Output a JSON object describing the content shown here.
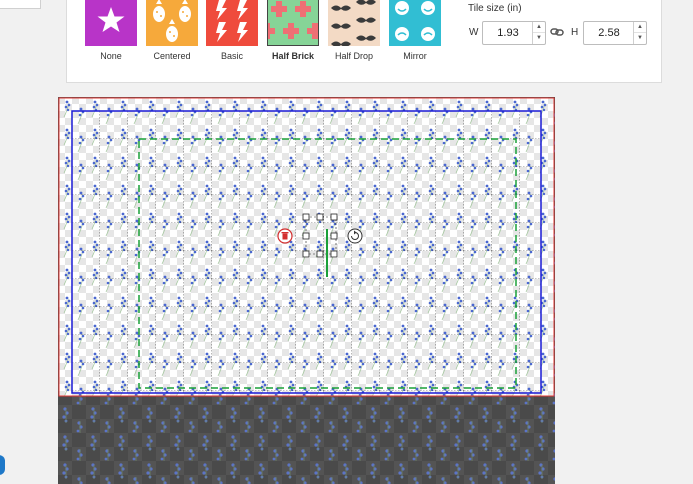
{
  "tile_types": {
    "items": [
      {
        "label": "None",
        "icon": "star-icon",
        "color": "#b834c8"
      },
      {
        "label": "Centered",
        "icon": "pineapple-icon",
        "color": "#f6a93b"
      },
      {
        "label": "Basic",
        "icon": "lightning-icon",
        "color": "#ef4b3c"
      },
      {
        "label": "Half Brick",
        "icon": "cross-pattern-icon",
        "color": "#86d497",
        "selected": true
      },
      {
        "label": "Half Drop",
        "icon": "mustache-icon",
        "color": "#f3dac5"
      },
      {
        "label": "Mirror",
        "icon": "smiley-icon",
        "color": "#31bed3"
      }
    ]
  },
  "tile_size": {
    "title": "Tile size (in)",
    "width_label": "W",
    "width_value": "1.93",
    "height_label": "H",
    "height_value": "2.58",
    "link_icon": "link-icon"
  },
  "canvas": {
    "bleed_color": "#e53935",
    "trim_color": "#1a1ad6",
    "safe_color": "#1aa038",
    "pattern_motif": "bluebell-flower",
    "tools": {
      "delete_icon": "trash-icon",
      "rotate_icon": "rotate-icon"
    }
  },
  "colors": {
    "accent": "#1e78c8",
    "background": "#f1f1f1"
  }
}
